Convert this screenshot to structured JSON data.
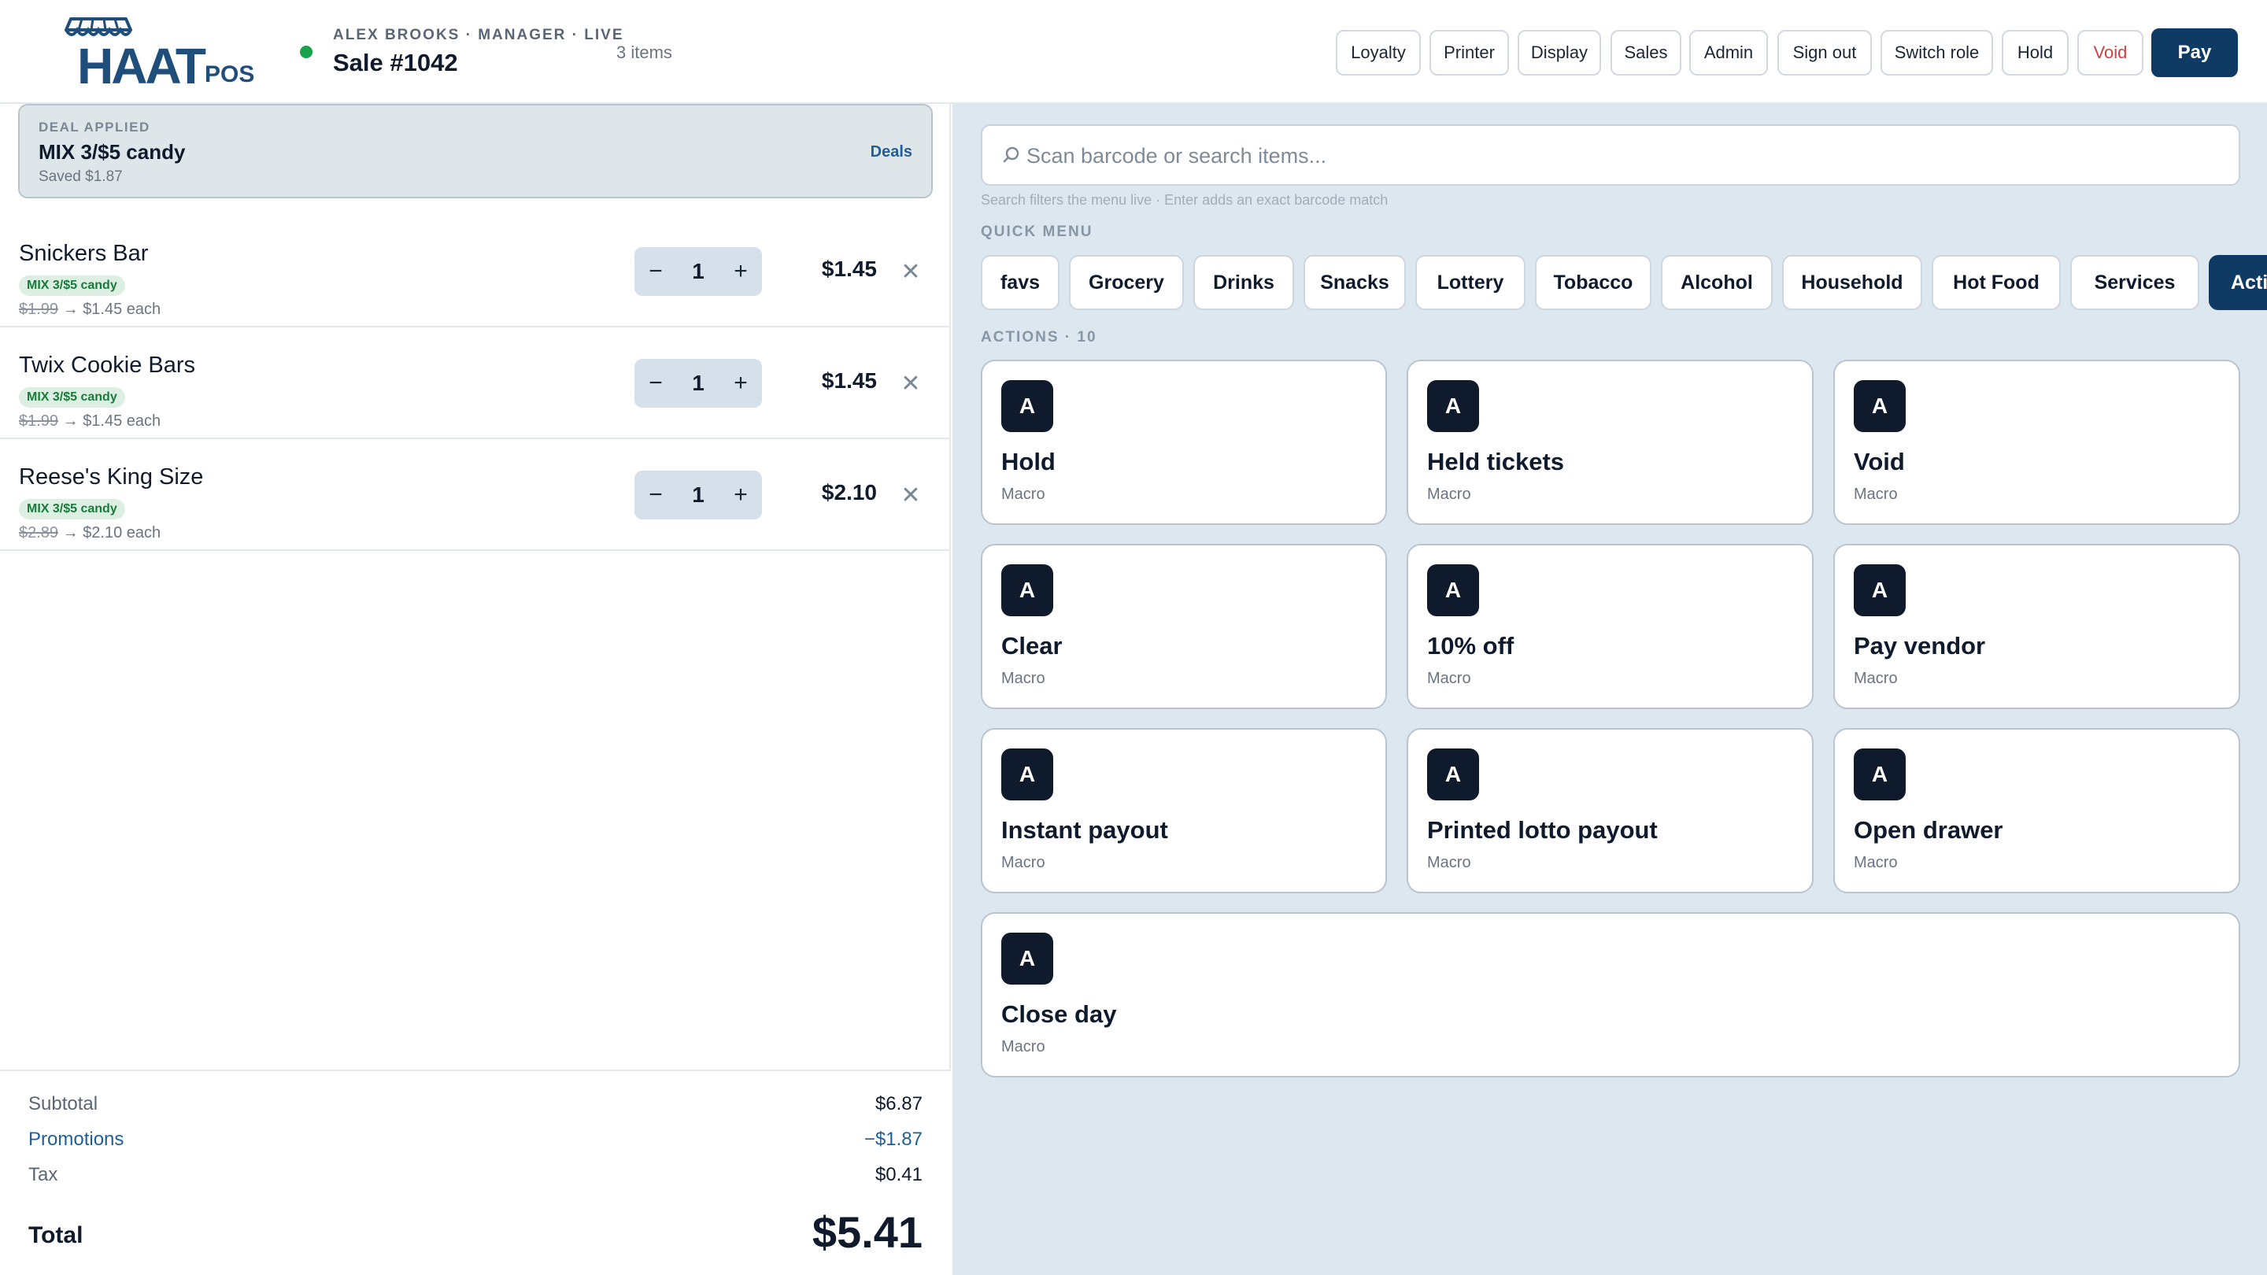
{
  "app": {
    "logo_word": "HAAT",
    "logo_suffix": "POS"
  },
  "header": {
    "meta": "ALEX BROOKS · MANAGER · LIVE",
    "title": "Sale #1042",
    "item_count": "3 items",
    "status_color": "#16a34a",
    "buttons": {
      "loyalty": "Loyalty",
      "printer": "Printer",
      "display": "Display",
      "sales": "Sales",
      "admin": "Admin",
      "sign_out": "Sign out",
      "switch_role": "Switch role",
      "hold": "Hold",
      "void": "Void",
      "pay": "Pay"
    }
  },
  "deal": {
    "kicker": "DEAL APPLIED",
    "name": "MIX 3/$5 candy",
    "saved": "Saved $1.87",
    "link": "Deals"
  },
  "cart": {
    "items": [
      {
        "name": "Snickers Bar",
        "badge": "MIX 3/$5 candy",
        "orig_price": "$1.99",
        "arrow": "→",
        "each": "$1.45 each",
        "qty": "1",
        "total": "$1.45"
      },
      {
        "name": "Twix Cookie Bars",
        "badge": "MIX 3/$5 candy",
        "orig_price": "$1.99",
        "arrow": "→",
        "each": "$1.45 each",
        "qty": "1",
        "total": "$1.45"
      },
      {
        "name": "Reese's King Size",
        "badge": "MIX 3/$5 candy",
        "orig_price": "$2.89",
        "arrow": "→",
        "each": "$2.10 each",
        "qty": "1",
        "total": "$2.10"
      }
    ],
    "qty_minus": "−",
    "qty_plus": "+",
    "remove_glyph": "✕"
  },
  "totals": {
    "subtotal_label": "Subtotal",
    "subtotal": "$6.87",
    "promotions_label": "Promotions",
    "promotions": "−$1.87",
    "tax_label": "Tax",
    "tax": "$0.41",
    "total_label": "Total",
    "total": "$5.41"
  },
  "search": {
    "placeholder": "Scan barcode or search items...",
    "hint": "Search filters the menu live · Enter adds an exact barcode match",
    "icon": "search-icon"
  },
  "quick_menu": {
    "label": "QUICK MENU",
    "categories": [
      "favs",
      "Grocery",
      "Drinks",
      "Snacks",
      "Lottery",
      "Tobacco",
      "Alcohol",
      "Household",
      "Hot Food",
      "Services",
      "Actions"
    ],
    "active": "Actions"
  },
  "actions": {
    "label": "ACTIONS · 10",
    "tiles": [
      {
        "icon_letter": "A",
        "name": "Hold",
        "sub": "Macro"
      },
      {
        "icon_letter": "A",
        "name": "Held tickets",
        "sub": "Macro"
      },
      {
        "icon_letter": "A",
        "name": "Void",
        "sub": "Macro"
      },
      {
        "icon_letter": "A",
        "name": "Clear",
        "sub": "Macro"
      },
      {
        "icon_letter": "A",
        "name": "10% off",
        "sub": "Macro"
      },
      {
        "icon_letter": "A",
        "name": "Pay vendor",
        "sub": "Macro"
      },
      {
        "icon_letter": "A",
        "name": "Instant payout",
        "sub": "Macro"
      },
      {
        "icon_letter": "A",
        "name": "Printed lotto payout",
        "sub": "Macro"
      },
      {
        "icon_letter": "A",
        "name": "Open drawer",
        "sub": "Macro"
      },
      {
        "icon_letter": "A",
        "name": "Close day",
        "sub": "Macro"
      }
    ]
  },
  "colors": {
    "brand": "#1f4e7a",
    "primary_button": "#0f3a63",
    "menu_background": "#dde7f0",
    "deal_badge_text": "#1a7a3c",
    "void_text": "#d04040"
  }
}
